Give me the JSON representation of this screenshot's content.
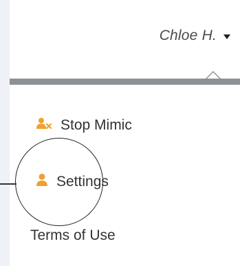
{
  "user_menu": {
    "user_name": "Chloe H.",
    "caret_icon": "caret-down-icon"
  },
  "menu": {
    "items": [
      {
        "label": "Stop Mimic",
        "icon": "user-remove-icon"
      },
      {
        "label": "Settings",
        "icon": "user-icon"
      },
      {
        "label": "Terms of Use"
      }
    ]
  },
  "colors": {
    "icon_accent": "#f0a030",
    "divider": "#8e9194",
    "text": "#333333"
  }
}
